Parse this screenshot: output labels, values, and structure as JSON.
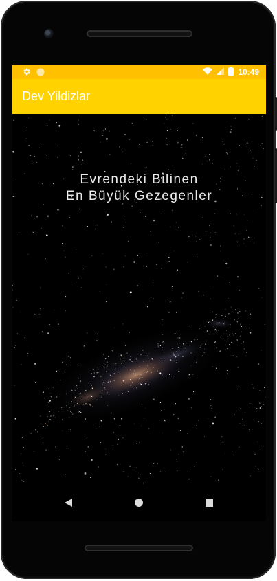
{
  "status_bar": {
    "time": "10:49",
    "left_icons": [
      "settings-gear-icon",
      "circle-status-icon"
    ],
    "right_icons": [
      "wifi-icon",
      "cell-signal-icon",
      "battery-icon"
    ],
    "color": "#FFC000"
  },
  "app_bar": {
    "title": "Dev Yildizlar",
    "color": "#FFD200"
  },
  "hero": {
    "line1": "Evrendeki Bilinen",
    "line2": "En Büyük Gezegenler"
  },
  "nav_bar": {
    "buttons": [
      "back-icon",
      "home-icon",
      "recents-icon"
    ]
  }
}
